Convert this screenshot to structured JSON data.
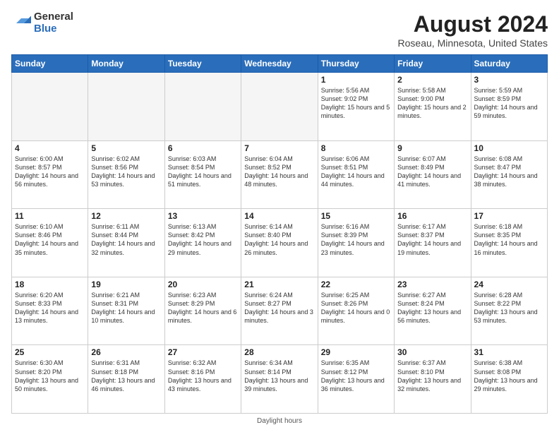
{
  "logo": {
    "general": "General",
    "blue": "Blue"
  },
  "header": {
    "title": "August 2024",
    "subtitle": "Roseau, Minnesota, United States"
  },
  "days_of_week": [
    "Sunday",
    "Monday",
    "Tuesday",
    "Wednesday",
    "Thursday",
    "Friday",
    "Saturday"
  ],
  "weeks": [
    [
      {
        "day": "",
        "empty": true
      },
      {
        "day": "",
        "empty": true
      },
      {
        "day": "",
        "empty": true
      },
      {
        "day": "",
        "empty": true
      },
      {
        "day": "1",
        "sunrise": "5:56 AM",
        "sunset": "9:02 PM",
        "daylight": "15 hours and 5 minutes."
      },
      {
        "day": "2",
        "sunrise": "5:58 AM",
        "sunset": "9:00 PM",
        "daylight": "15 hours and 2 minutes."
      },
      {
        "day": "3",
        "sunrise": "5:59 AM",
        "sunset": "8:59 PM",
        "daylight": "14 hours and 59 minutes."
      }
    ],
    [
      {
        "day": "4",
        "sunrise": "6:00 AM",
        "sunset": "8:57 PM",
        "daylight": "14 hours and 56 minutes."
      },
      {
        "day": "5",
        "sunrise": "6:02 AM",
        "sunset": "8:56 PM",
        "daylight": "14 hours and 53 minutes."
      },
      {
        "day": "6",
        "sunrise": "6:03 AM",
        "sunset": "8:54 PM",
        "daylight": "14 hours and 51 minutes."
      },
      {
        "day": "7",
        "sunrise": "6:04 AM",
        "sunset": "8:52 PM",
        "daylight": "14 hours and 48 minutes."
      },
      {
        "day": "8",
        "sunrise": "6:06 AM",
        "sunset": "8:51 PM",
        "daylight": "14 hours and 44 minutes."
      },
      {
        "day": "9",
        "sunrise": "6:07 AM",
        "sunset": "8:49 PM",
        "daylight": "14 hours and 41 minutes."
      },
      {
        "day": "10",
        "sunrise": "6:08 AM",
        "sunset": "8:47 PM",
        "daylight": "14 hours and 38 minutes."
      }
    ],
    [
      {
        "day": "11",
        "sunrise": "6:10 AM",
        "sunset": "8:46 PM",
        "daylight": "14 hours and 35 minutes."
      },
      {
        "day": "12",
        "sunrise": "6:11 AM",
        "sunset": "8:44 PM",
        "daylight": "14 hours and 32 minutes."
      },
      {
        "day": "13",
        "sunrise": "6:13 AM",
        "sunset": "8:42 PM",
        "daylight": "14 hours and 29 minutes."
      },
      {
        "day": "14",
        "sunrise": "6:14 AM",
        "sunset": "8:40 PM",
        "daylight": "14 hours and 26 minutes."
      },
      {
        "day": "15",
        "sunrise": "6:16 AM",
        "sunset": "8:39 PM",
        "daylight": "14 hours and 23 minutes."
      },
      {
        "day": "16",
        "sunrise": "6:17 AM",
        "sunset": "8:37 PM",
        "daylight": "14 hours and 19 minutes."
      },
      {
        "day": "17",
        "sunrise": "6:18 AM",
        "sunset": "8:35 PM",
        "daylight": "14 hours and 16 minutes."
      }
    ],
    [
      {
        "day": "18",
        "sunrise": "6:20 AM",
        "sunset": "8:33 PM",
        "daylight": "14 hours and 13 minutes."
      },
      {
        "day": "19",
        "sunrise": "6:21 AM",
        "sunset": "8:31 PM",
        "daylight": "14 hours and 10 minutes."
      },
      {
        "day": "20",
        "sunrise": "6:23 AM",
        "sunset": "8:29 PM",
        "daylight": "14 hours and 6 minutes."
      },
      {
        "day": "21",
        "sunrise": "6:24 AM",
        "sunset": "8:27 PM",
        "daylight": "14 hours and 3 minutes."
      },
      {
        "day": "22",
        "sunrise": "6:25 AM",
        "sunset": "8:26 PM",
        "daylight": "14 hours and 0 minutes."
      },
      {
        "day": "23",
        "sunrise": "6:27 AM",
        "sunset": "8:24 PM",
        "daylight": "13 hours and 56 minutes."
      },
      {
        "day": "24",
        "sunrise": "6:28 AM",
        "sunset": "8:22 PM",
        "daylight": "13 hours and 53 minutes."
      }
    ],
    [
      {
        "day": "25",
        "sunrise": "6:30 AM",
        "sunset": "8:20 PM",
        "daylight": "13 hours and 50 minutes."
      },
      {
        "day": "26",
        "sunrise": "6:31 AM",
        "sunset": "8:18 PM",
        "daylight": "13 hours and 46 minutes."
      },
      {
        "day": "27",
        "sunrise": "6:32 AM",
        "sunset": "8:16 PM",
        "daylight": "13 hours and 43 minutes."
      },
      {
        "day": "28",
        "sunrise": "6:34 AM",
        "sunset": "8:14 PM",
        "daylight": "13 hours and 39 minutes."
      },
      {
        "day": "29",
        "sunrise": "6:35 AM",
        "sunset": "8:12 PM",
        "daylight": "13 hours and 36 minutes."
      },
      {
        "day": "30",
        "sunrise": "6:37 AM",
        "sunset": "8:10 PM",
        "daylight": "13 hours and 32 minutes."
      },
      {
        "day": "31",
        "sunrise": "6:38 AM",
        "sunset": "8:08 PM",
        "daylight": "13 hours and 29 minutes."
      }
    ]
  ],
  "footer": {
    "daylight_label": "Daylight hours"
  }
}
